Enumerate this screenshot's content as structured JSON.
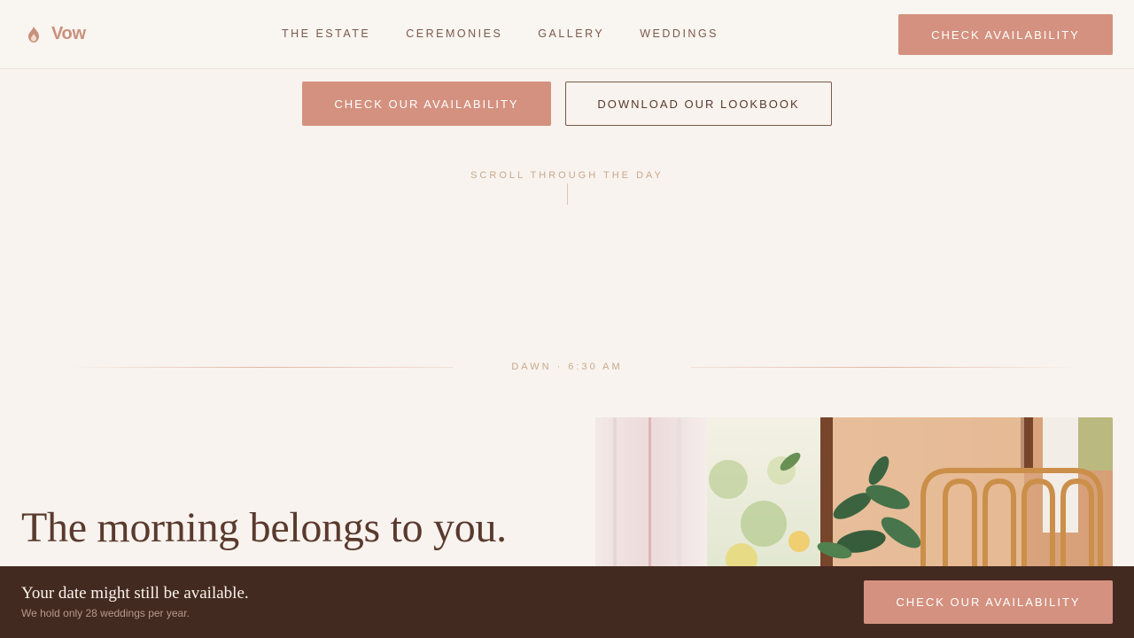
{
  "header": {
    "logo_text": "Vow",
    "nav": [
      "THE ESTATE",
      "CEREMONIES",
      "GALLERY",
      "WEDDINGS"
    ],
    "cta_label": "CHECK AVAILABILITY"
  },
  "hero": {
    "primary_cta": "CHECK OUR AVAILABILITY",
    "secondary_cta": "DOWNLOAD OUR LOOKBOOK",
    "scroll_hint": "SCROLL THROUGH THE DAY"
  },
  "section": {
    "time_label": "DAWN · 6:30 AM",
    "heading": "The morning belongs to you."
  },
  "sticky": {
    "title": "Your date might still be available.",
    "subtitle": "We hold only 28 weddings per year.",
    "cta_label": "CHECK OUR AVAILABILITY"
  },
  "colors": {
    "accent": "#d4917f",
    "background": "#f8f3ee",
    "dark": "#432a20",
    "text": "#5a3a2e"
  },
  "icons": {
    "logo": "flame-icon"
  }
}
